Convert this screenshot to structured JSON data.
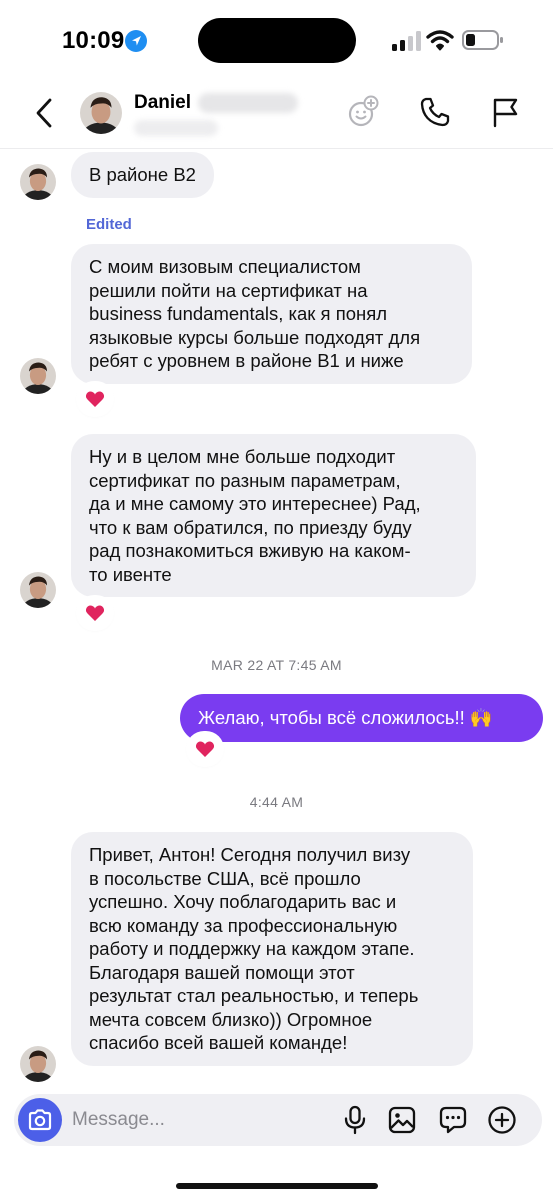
{
  "status_bar": {
    "time": "10:09"
  },
  "header": {
    "contact_name": "Daniel",
    "icons": [
      "chevron-left-icon",
      "emoji-add-icon",
      "phone-icon",
      "flag-icon"
    ]
  },
  "messages": {
    "m1": {
      "text": "В районе В2"
    },
    "edited_label": "Edited",
    "m2": {
      "text": "С моим визовым специалистом\nрешили пойти на сертификат на\nbusiness fundamentals, как я понял\nязыковые курсы больше подходят для\nребят с уровнем в районе В1 и ниже",
      "reaction": "❤️"
    },
    "m3": {
      "text": "Ну и в целом мне больше подходит\nсертификат по разным параметрам,\nда и мне самому это интереснее) Рад,\nчто к вам обратился, по приезду буду\nрад познакомиться вживую на каком-\nто ивенте",
      "reaction": "❤️"
    },
    "ts1": "MAR 22 AT 7:45 AM",
    "m4": {
      "text": "Желаю, чтобы всё сложилось!! 🙌",
      "reaction": "❤️"
    },
    "ts2": "4:44 AM",
    "m5": {
      "text": "Привет, Антон! Сегодня получил визу\nв посольстве США, всё прошло\nуспешно. Хочу поблагодарить вас и\nвсю команду за профессиональную\nработу и поддержку на каждом этапе.\nБлагодаря вашей помощи этот\nрезультат стал реальностью, и теперь\nмечта совсем близко)) Огромное\nспасибо всей вашей команде!"
    }
  },
  "composer": {
    "placeholder": "Message...",
    "icons": [
      "camera-icon",
      "mic-icon",
      "gallery-icon",
      "sticker-icon",
      "plus-icon"
    ]
  },
  "colors": {
    "outgoing_bubble": "#7a3cf0",
    "incoming_bubble": "#efeff3",
    "edited_label": "#5367d6",
    "camera_button": "#4c5fe8",
    "reaction_heart": "#e0245e"
  }
}
